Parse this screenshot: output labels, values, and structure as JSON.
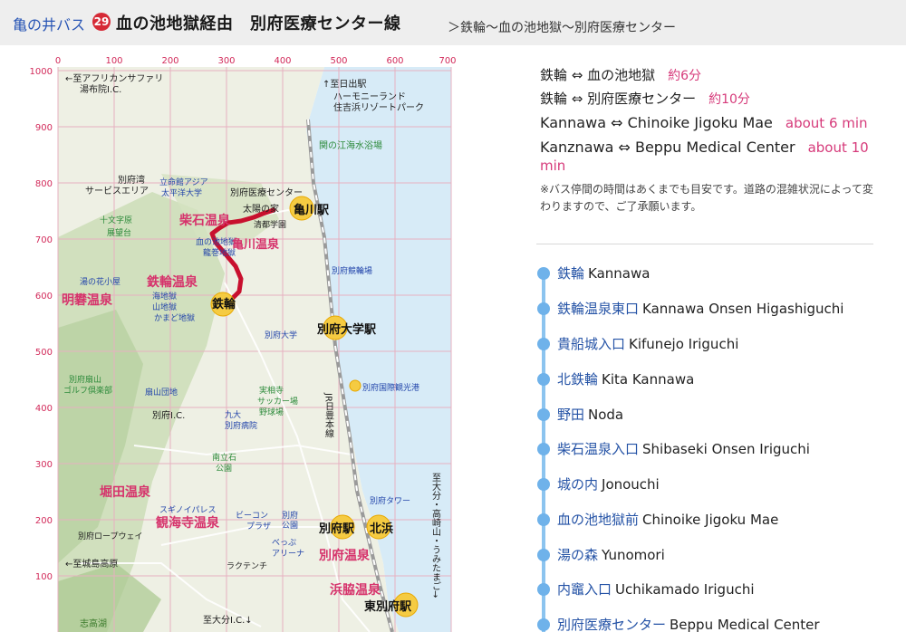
{
  "header": {
    "brand": "亀の井バス",
    "route_number": "29",
    "title": "血の池地獄経由　別府医療センター線",
    "route_path": "＞鉄輪〜血の池地獄〜別府医療センター"
  },
  "map": {
    "x_ticks": [
      "0",
      "100",
      "200",
      "300",
      "400",
      "500",
      "600",
      "700"
    ],
    "y_ticks": [
      "1000",
      "900",
      "800",
      "700",
      "600",
      "500",
      "400",
      "300",
      "200",
      "100"
    ],
    "labels": {
      "afurikan": "←至アフリカンサファリ",
      "yufuin_ic": "湯布院I.C.",
      "hiji": "↑至日出駅",
      "harmony": "ハーモニーランド",
      "sumiyoshi": "住吉浜リゾートパーク",
      "seki_kaisui": "関の江海水浴場",
      "beppu_sa1": "別府湾",
      "beppu_sa2": "サービスエリア",
      "apu1": "立命館アジア",
      "apu2": "太平洋大学",
      "iryo_center": "別府医療センター",
      "taiyo_ie": "太陽の家",
      "seibu": "清都学園",
      "jumonji1": "十文字原",
      "jumonji2": "展望台",
      "shibaseki": "柴石温泉",
      "chinoike1": "血の池地獄",
      "chinoike2": "龍巻地獄",
      "kamegawa_onsen": "亀川温泉",
      "kamegawa_sta": "亀川駅",
      "keirin": "別府競輪場",
      "yunohana": "湯の花小屋",
      "kannawa_onsen": "鉄輪温泉",
      "myoban": "明礬温泉",
      "umijigoku": "海地獄",
      "yamajigoku": "山地獄",
      "kamado": "かまど地獄",
      "kannawa_sta": "鉄輪",
      "beppu_uni_sta": "別府大学駅",
      "beppu_uni": "別府大学",
      "kokusai_port": "別府国際観光港",
      "ougiyama_golf1": "別府扇山",
      "ougiyama_golf2": "ゴルフ倶楽部",
      "ougiyama": "扇山団地",
      "jissoji1": "実相寺",
      "jissoji2": "サッカー場",
      "jissoji3": "野球場",
      "jr_line": "JR日豊本線",
      "beppu_ic": "別府I.C.",
      "kyudai1": "九大",
      "kyudai2": "別府病院",
      "minamitate1": "南立石",
      "minamitate2": "公園",
      "horita": "堀田温泉",
      "suginoi": "スギノイパレス",
      "kankaiji": "観海寺温泉",
      "beacon": "ビーコン",
      "plaza": "プラザ",
      "beppu_park1": "別府",
      "beppu_park2": "公園",
      "beppu_arena1": "べっぷ",
      "beppu_arena2": "アリーナ",
      "ropeway": "別府ロープウェイ",
      "beppu_tower": "別府タワー",
      "beppu_sta": "別府駅",
      "kitahama": "北浜",
      "beppu_onsen": "別府温泉",
      "kijima": "←至城島高原",
      "rakutenchi": "ラクテンチ",
      "hamawaki": "浜脇温泉",
      "higashi_beppu": "東別府駅",
      "shitakayu": "志高湖",
      "oita_ic": "至大分I.C.↓",
      "oita_right": "至大分・高崎山・うみたまご→"
    }
  },
  "times": [
    {
      "text": "鉄輪 ⇔ 血の池地獄",
      "duration": "約6分",
      "lang": "jp"
    },
    {
      "text": "鉄輪 ⇔ 別府医療センター",
      "duration": "約10分",
      "lang": "jp"
    },
    {
      "text": "Kannawa ⇔ Chinoike Jigoku Mae",
      "duration": "about 6 min",
      "lang": "en"
    },
    {
      "text": "Kanznawa ⇔ Beppu Medical Center",
      "duration": "about 10 min",
      "lang": "en"
    }
  ],
  "note": "※バス停間の時間はあくまでも目安です。道路の混雑状況によって変わりますので、ご了承願います。",
  "stops": [
    {
      "jp": "鉄輪",
      "en": "Kannawa"
    },
    {
      "jp": "鉄輪温泉東口",
      "en": "Kannawa Onsen Higashiguchi"
    },
    {
      "jp": "貴船城入口",
      "en": "Kifunejo Iriguchi"
    },
    {
      "jp": "北鉄輪",
      "en": "Kita Kannawa"
    },
    {
      "jp": "野田",
      "en": "Noda"
    },
    {
      "jp": "柴石温泉入口",
      "en": "Shibaseki Onsen Iriguchi"
    },
    {
      "jp": "城の内",
      "en": "Jonouchi"
    },
    {
      "jp": "血の池地獄前",
      "en": "Chinoike Jigoku Mae"
    },
    {
      "jp": "湯の森",
      "en": "Yunomori"
    },
    {
      "jp": "内竈入口",
      "en": "Uchikamado Iriguchi"
    },
    {
      "jp": "別府医療センター",
      "en": "Beppu Medical Center"
    }
  ]
}
